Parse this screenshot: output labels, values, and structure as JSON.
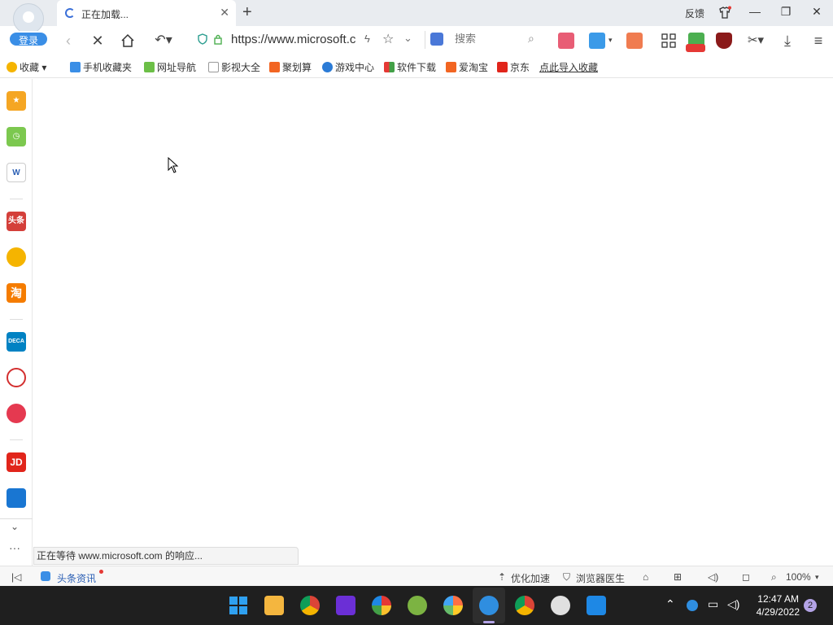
{
  "tabbar": {
    "login_label": "登录",
    "tab_title": "正在加载...",
    "feedback_label": "反馈"
  },
  "address": {
    "url_host": "https://www.microsoft.c",
    "search_placeholder": "搜索"
  },
  "bookmarks": {
    "favorites_label": "收藏",
    "items": [
      "手机收藏夹",
      "网址导航",
      "影视大全",
      "聚划算",
      "游戏中心",
      "软件下载",
      "爱淘宝",
      "京东",
      "点此导入收藏"
    ]
  },
  "sidebar": {
    "items": [
      "favorites",
      "history",
      "word",
      "toutiao",
      "weibo",
      "taobao",
      "decathlon",
      "ele",
      "koala",
      "jd",
      "ctrip"
    ],
    "toutiao_label": "头条",
    "taobao_label": "淘",
    "decathlon_label": "DECA",
    "jd_label": "JD"
  },
  "content": {
    "status_message": "正在等待 www.microsoft.com 的响应..."
  },
  "statusbar": {
    "news_label": "头条资讯",
    "optimize_label": "优化加速",
    "doctor_label": "浏览器医生",
    "zoom_label": "100%"
  },
  "taskbar": {
    "time": "12:47 AM",
    "date": "4/29/2022",
    "notifications": "2"
  },
  "colors": {
    "accent": "#3a8ee6",
    "taskbar_bg": "#1f1f1f"
  }
}
